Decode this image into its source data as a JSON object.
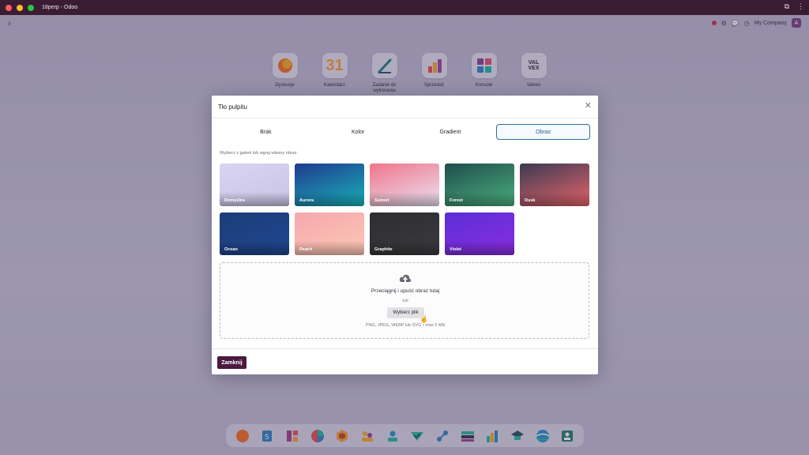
{
  "window": {
    "title": "18perp - Odoo"
  },
  "topbar": {
    "company": "My Company",
    "avatar_letter": "A"
  },
  "apps": [
    {
      "label": "Dyskusje",
      "icon": "discuss-icon"
    },
    {
      "label": "Kalendarz",
      "icon": "calendar-icon",
      "glyph": "31"
    },
    {
      "label": "Zadanie do wykonania",
      "icon": "todo-icon"
    },
    {
      "label": "Sprzedaż",
      "icon": "sales-icon"
    },
    {
      "label": "Konsole",
      "icon": "consoles-icon"
    },
    {
      "label": "Valvex",
      "icon": "valvex-icon",
      "glyph": "VAL VEX"
    }
  ],
  "modal": {
    "title": "Tło pulpitu",
    "tabs": [
      "Brak",
      "Kolor",
      "Gradient",
      "Obraz"
    ],
    "active_tab": "Obraz",
    "hint": "Wybierz z galerii lub wgraj własny obraz.",
    "gallery": [
      {
        "label": "Domyślne",
        "colors": [
          "#d9d4f0",
          "#c9c4e6"
        ]
      },
      {
        "label": "Aurora",
        "colors": [
          "#1f3a8f",
          "#19b2b8"
        ]
      },
      {
        "label": "Sunset",
        "colors": [
          "#f0758a",
          "#e9e2f2"
        ]
      },
      {
        "label": "Forest",
        "colors": [
          "#1e4d4d",
          "#4caf7d"
        ]
      },
      {
        "label": "Dusk",
        "colors": [
          "#3c3a52",
          "#e4646a"
        ]
      },
      {
        "label": "Ocean",
        "colors": [
          "#1d3d7a",
          "#1f4690"
        ]
      },
      {
        "label": "Peach",
        "colors": [
          "#f6a7ae",
          "#fbc8b4"
        ]
      },
      {
        "label": "Graphite",
        "colors": [
          "#2e2e30",
          "#3a3a3d"
        ]
      },
      {
        "label": "Violet",
        "colors": [
          "#5a2fd6",
          "#8b2ce0"
        ]
      }
    ],
    "dropzone": {
      "text": "Przeciągnij i upuść obraz tutaj",
      "or": "lub",
      "button": "Wybierz plik",
      "formats": "PNG, JPEG, WEBP lub SVG • max 5 MB"
    },
    "close_button": "Zamknij"
  },
  "dock": [
    "discuss-icon",
    "document-icon",
    "contacts-icon",
    "dashboard-icon",
    "inventory-icon",
    "team-icon",
    "employees-icon",
    "check-icon",
    "link-icon",
    "planning-icon",
    "reporting-icon",
    "elearning-icon",
    "globe-icon",
    "profile-icon"
  ]
}
